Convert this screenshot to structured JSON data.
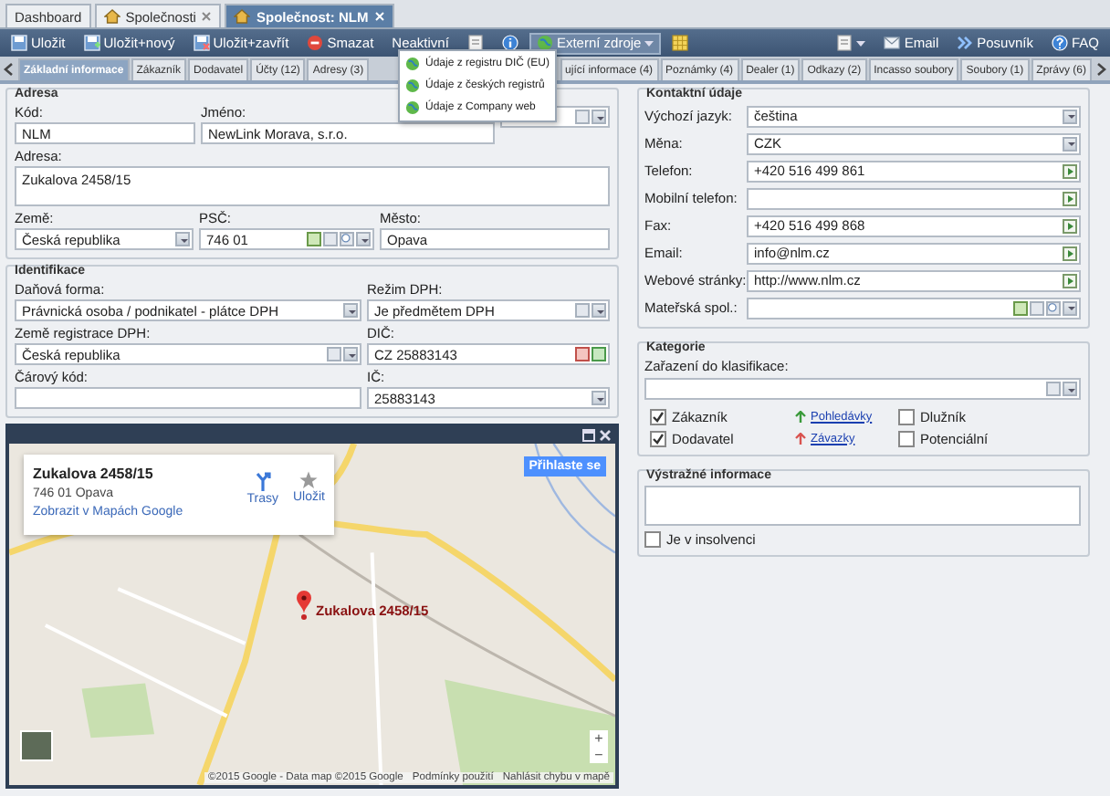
{
  "top_tabs": [
    {
      "label": "Dashboard",
      "kind": "plain",
      "selected": false
    },
    {
      "label": "Společnosti",
      "kind": "closable",
      "selected": false
    },
    {
      "label": "Společnost: NLM",
      "kind": "closable",
      "selected": true
    }
  ],
  "toolbar": {
    "left": [
      {
        "kind": "save",
        "label": "Uložit"
      },
      {
        "kind": "save-new",
        "label": "Uložit+nový"
      },
      {
        "kind": "save-close",
        "label": "Uložit+zavřít"
      },
      {
        "kind": "delete",
        "label": "Smazat"
      },
      {
        "kind": "text",
        "label": "Neaktivní"
      },
      {
        "kind": "note"
      },
      {
        "kind": "info"
      },
      {
        "kind": "menu",
        "label": "Externí zdroje",
        "expanded": true
      },
      {
        "kind": "grid"
      }
    ],
    "right": [
      {
        "kind": "view-menu"
      },
      {
        "kind": "email",
        "label": "Email"
      },
      {
        "kind": "scroll",
        "label": "Posuvník"
      },
      {
        "kind": "help",
        "label": "FAQ"
      }
    ]
  },
  "external_menu": [
    "Údaje z registru DIČ (EU)",
    "Údaje z českých registrů",
    "Údaje z Company web"
  ],
  "tabs": [
    {
      "label": "Základní informace",
      "selected": true
    },
    {
      "label": "Zákazník",
      "selected": false
    },
    {
      "label": "Dodavatel",
      "selected": false
    },
    {
      "label": "Účty (12)",
      "selected": false
    },
    {
      "label": "Adresy (3)",
      "selected": false
    },
    {
      "label": "ující informace (4)",
      "selected": false
    },
    {
      "label": "Poznámky (4)",
      "selected": false
    },
    {
      "label": "Dealer (1)",
      "selected": false
    },
    {
      "label": "Odkazy (2)",
      "selected": false
    },
    {
      "label": "Incasso soubory",
      "selected": false
    },
    {
      "label": "Soubory (1)",
      "selected": false
    },
    {
      "label": "Zprávy (6)",
      "selected": false
    }
  ],
  "address": {
    "title": "Adresa",
    "rows": [
      [
        {
          "label": "Kód:",
          "value": "NLM",
          "kind": "text"
        },
        {
          "label": "Jméno:",
          "value": "NewLink Morava, s.r.o.",
          "kind": "text"
        },
        {
          "kind": "lookup"
        }
      ],
      [
        {
          "label": "Adresa:",
          "value": "Zukalova 2458/15",
          "kind": "textarea"
        }
      ],
      [
        {
          "label": "Země:",
          "value": "Česká republika",
          "kind": "select"
        },
        {
          "label": "PSČ:",
          "value": "746 01",
          "kind": "lookup-add"
        },
        {
          "label": "Město:",
          "value": "Opava",
          "kind": "text"
        }
      ]
    ]
  },
  "identification": {
    "title": "Identifikace",
    "rows": [
      [
        {
          "label": "Daňová forma:",
          "value": "Právnická osoba / podnikatel - plátce DPH",
          "kind": "select"
        },
        {
          "label": "Režim DPH:",
          "value": "Je předmětem DPH",
          "kind": "clear-select"
        }
      ],
      [
        {
          "label": "Země registrace DPH:",
          "value": "Česká republika",
          "kind": "clear-select"
        },
        {
          "label": "DIČ:",
          "value": "CZ 25883143",
          "kind": "dic"
        }
      ],
      [
        {
          "label": "Čárový kód:",
          "kind": "text"
        },
        {
          "label": "IČ:",
          "value": "25883143",
          "kind": "ic"
        }
      ]
    ]
  },
  "map": {
    "card": {
      "title": "Zukalova 2458/15",
      "address": "746 01 Opava",
      "link": "Zobrazit v Mapách Google",
      "actions": [
        {
          "kind": "route",
          "label": "Trasy"
        },
        {
          "kind": "save",
          "label": "Uložit"
        }
      ]
    },
    "sign_in": "Přihlaste se",
    "marker_label": "Zukalova 2458/15",
    "zoom": [
      "+",
      "−"
    ],
    "footer": [
      "©2015 Google - Data map ©2015 Google",
      "Podmínky použití",
      "Nahlásit chybu v mapě"
    ]
  },
  "contact": {
    "title": "Kontaktní údaje",
    "fields": [
      {
        "label": "Výchozí jazyk:",
        "value": "čeština",
        "kind": "select"
      },
      {
        "label": "Měna:",
        "value": "CZK",
        "kind": "select"
      },
      {
        "label": "Telefon:",
        "value": "+420 516 499 861",
        "kind": "go"
      },
      {
        "label": "Mobilní telefon:",
        "kind": "go"
      },
      {
        "label": "Fax:",
        "value": "+420 516 499 868",
        "kind": "go"
      },
      {
        "label": "Email:",
        "value": "info@nlm.cz",
        "kind": "go"
      },
      {
        "label": "Webové stránky:",
        "value": "http://www.nlm.cz",
        "kind": "go"
      },
      {
        "label": "Mateřská spol.:",
        "kind": "lookup-add"
      }
    ]
  },
  "categories": {
    "title": "Kategorie",
    "label": "Zařazení do klasifikace:",
    "columns": [
      {
        "kind": "checks",
        "items": [
          {
            "label": "Zákazník",
            "checked": true
          },
          {
            "label": "Dodavatel",
            "checked": true
          }
        ]
      },
      {
        "kind": "links",
        "items": [
          {
            "label": "Pohledávky",
            "kind": "in"
          },
          {
            "label": "Závazky",
            "kind": "out"
          }
        ]
      },
      {
        "kind": "checks",
        "items": [
          {
            "label": "Dlužník",
            "checked": false
          },
          {
            "label": "Potenciální",
            "checked": false
          }
        ]
      }
    ]
  },
  "warnings": {
    "title": "Výstražné informace",
    "insolvency": {
      "label": "Je v insolvenci",
      "checked": false
    }
  }
}
